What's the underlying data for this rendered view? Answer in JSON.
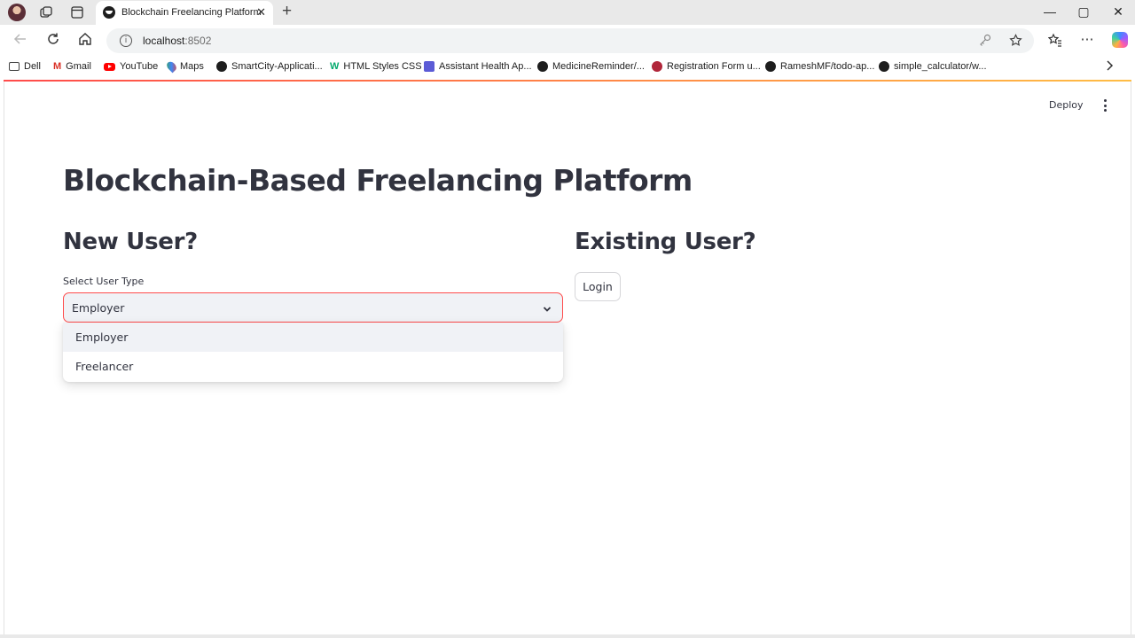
{
  "browser": {
    "tab": {
      "title": "Blockchain Freelancing Platform",
      "close": "✕"
    },
    "new_tab": "+",
    "window_controls": {
      "minimize": "—",
      "maximize": "▢",
      "close": "✕"
    },
    "address": {
      "host": "localhost",
      "port": ":8502"
    },
    "bookmarks": [
      {
        "label": "Dell",
        "icon": "folder-icon"
      },
      {
        "label": "Gmail",
        "icon": "gmail-icon"
      },
      {
        "label": "YouTube",
        "icon": "youtube-icon"
      },
      {
        "label": "Maps",
        "icon": "maps-icon"
      },
      {
        "label": "SmartCity-Applicati...",
        "icon": "github-icon"
      },
      {
        "label": "HTML Styles CSS",
        "icon": "w3schools-icon"
      },
      {
        "label": "Assistant Health Ap...",
        "icon": "app-icon"
      },
      {
        "label": "MedicineReminder/...",
        "icon": "github-icon"
      },
      {
        "label": "Registration Form u...",
        "icon": "site-icon"
      },
      {
        "label": "RameshMF/todo-ap...",
        "icon": "github-icon"
      },
      {
        "label": "simple_calculator/w...",
        "icon": "github-icon"
      }
    ]
  },
  "app": {
    "toolbar": {
      "deploy_label": "Deploy"
    },
    "title": "Blockchain-Based Freelancing Platform",
    "new_user": {
      "heading": "New User?",
      "select_label": "Select User Type",
      "selected": "Employer",
      "options": [
        "Employer",
        "Freelancer"
      ]
    },
    "existing_user": {
      "heading": "Existing User?",
      "login_label": "Login"
    }
  },
  "colors": {
    "accent": "#ff4b4b",
    "accent_end": "#ffbd45",
    "text": "#31333f",
    "input_bg": "#f0f2f6"
  }
}
